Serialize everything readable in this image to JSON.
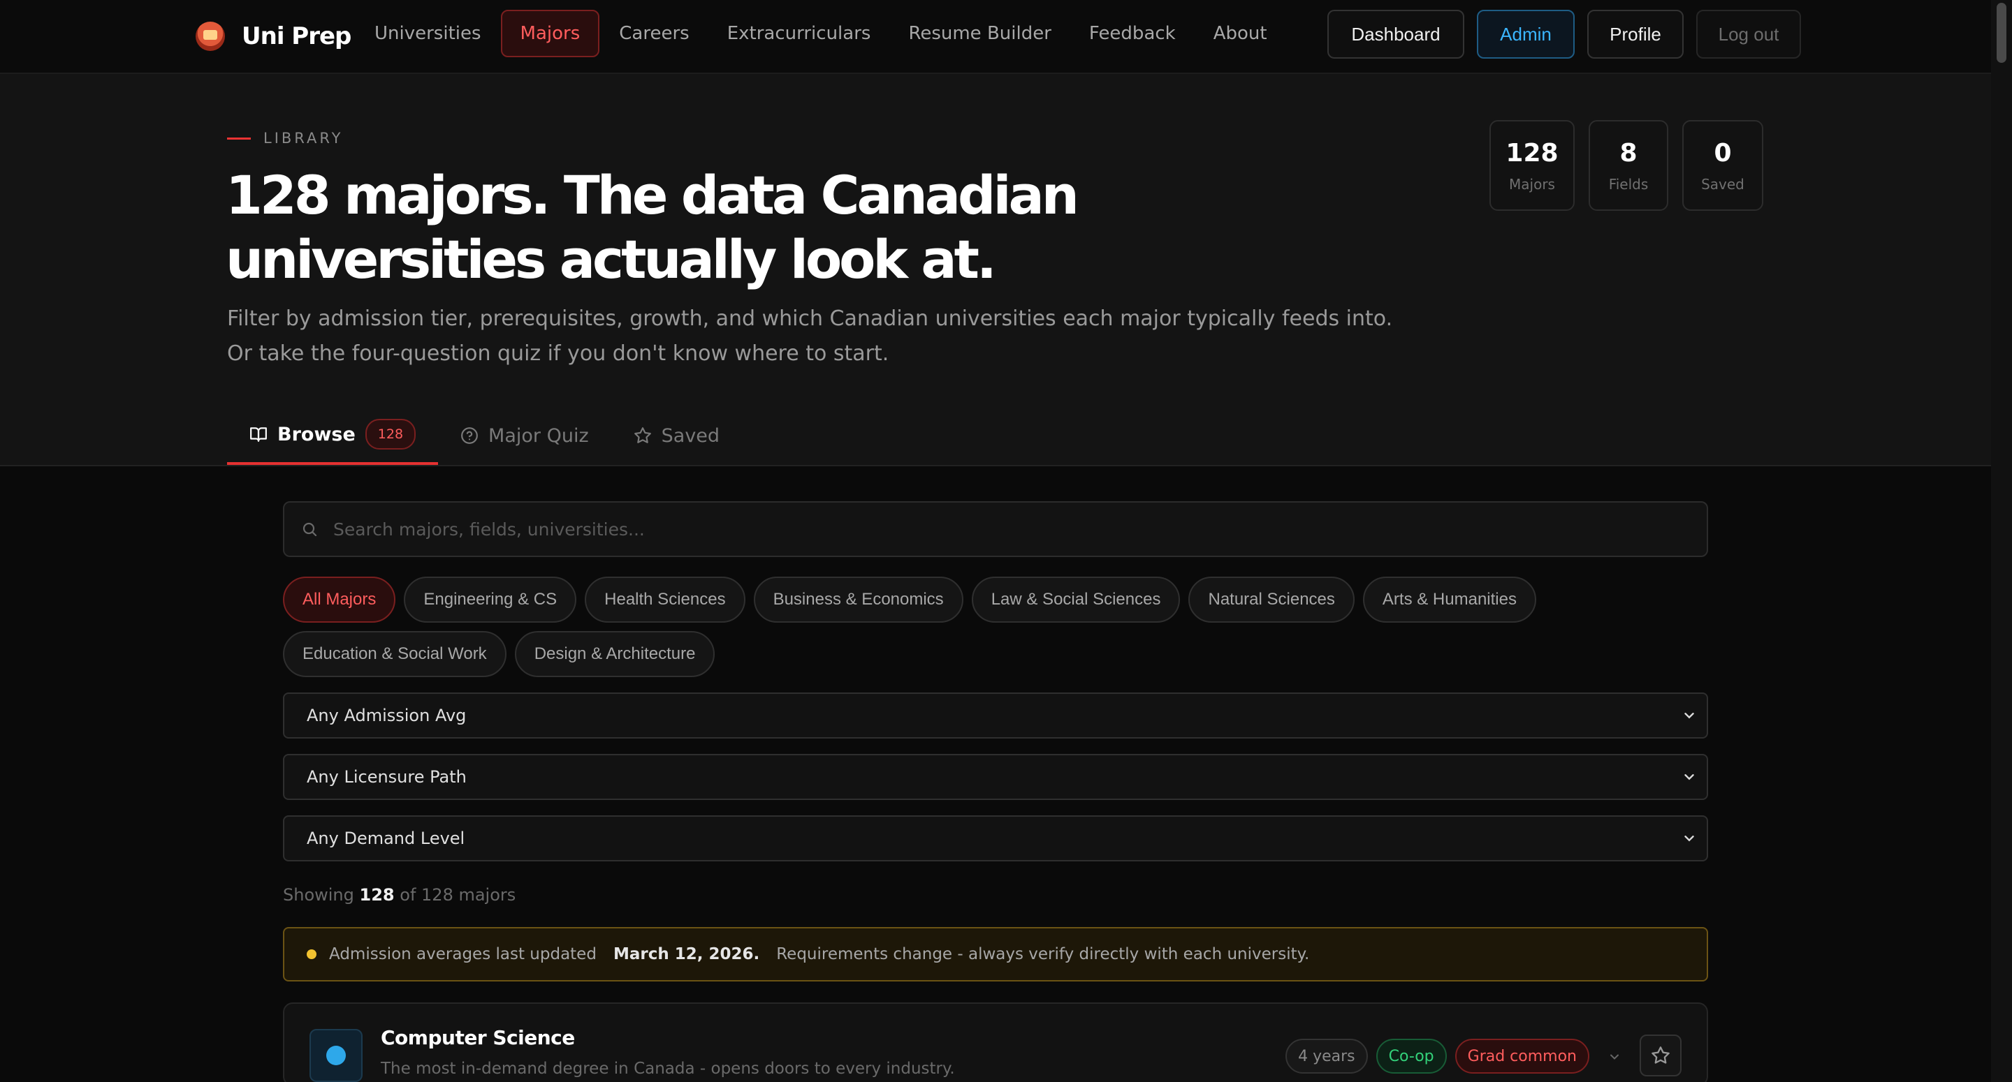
{
  "brand": {
    "name": "Uni Prep"
  },
  "nav": {
    "links": [
      {
        "label": "Universities",
        "active": false
      },
      {
        "label": "Majors",
        "active": true
      },
      {
        "label": "Careers",
        "active": false
      },
      {
        "label": "Extracurriculars",
        "active": false
      },
      {
        "label": "Resume Builder",
        "active": false
      },
      {
        "label": "Feedback",
        "active": false
      },
      {
        "label": "About",
        "active": false
      }
    ],
    "buttons": {
      "dashboard": "Dashboard",
      "admin": "Admin",
      "profile": "Profile",
      "logout": "Log out"
    }
  },
  "hero": {
    "eyebrow": "LIBRARY",
    "title_line1": "128 majors. The data Canadian",
    "title_line2": "universities actually look at.",
    "subtitle_line1": "Filter by admission tier, prerequisites, growth, and which Canadian universities each major typically feeds into.",
    "subtitle_line2": "Or take the four-question quiz if you don't know where to start.",
    "stats": [
      {
        "value": "128",
        "label": "Majors"
      },
      {
        "value": "8",
        "label": "Fields"
      },
      {
        "value": "0",
        "label": "Saved"
      }
    ]
  },
  "tabs": {
    "browse": "Browse",
    "browse_count": "128",
    "quiz": "Major Quiz",
    "saved": "Saved"
  },
  "search": {
    "placeholder": "Search majors, fields, universities..."
  },
  "chips": [
    {
      "label": "All Majors",
      "active": true
    },
    {
      "label": "Engineering & CS",
      "active": false
    },
    {
      "label": "Health Sciences",
      "active": false
    },
    {
      "label": "Business & Economics",
      "active": false
    },
    {
      "label": "Law & Social Sciences",
      "active": false
    },
    {
      "label": "Natural Sciences",
      "active": false
    },
    {
      "label": "Arts & Humanities",
      "active": false
    },
    {
      "label": "Education & Social Work",
      "active": false
    },
    {
      "label": "Design & Architecture",
      "active": false
    }
  ],
  "filters": {
    "admission": "Any Admission Avg",
    "licensure": "Any Licensure Path",
    "demand": "Any Demand Level"
  },
  "results": {
    "prefix": "Showing",
    "shown": "128",
    "suffix": "of 128 majors"
  },
  "notice": {
    "lead": "Admission averages last updated",
    "date": "March 12, 2026.",
    "trail": "Requirements change - always verify directly with each university."
  },
  "card": {
    "title": "Computer Science",
    "description": "The most in-demand degree in Canada - opens doors to every industry.",
    "tags": {
      "years": "4 years",
      "coop": "Co-op",
      "grad": "Grad common"
    }
  },
  "colors": {
    "accent": "#e53131",
    "admin": "#3bb6ff",
    "coop": "#33d17a",
    "notice": "#f2c230"
  }
}
